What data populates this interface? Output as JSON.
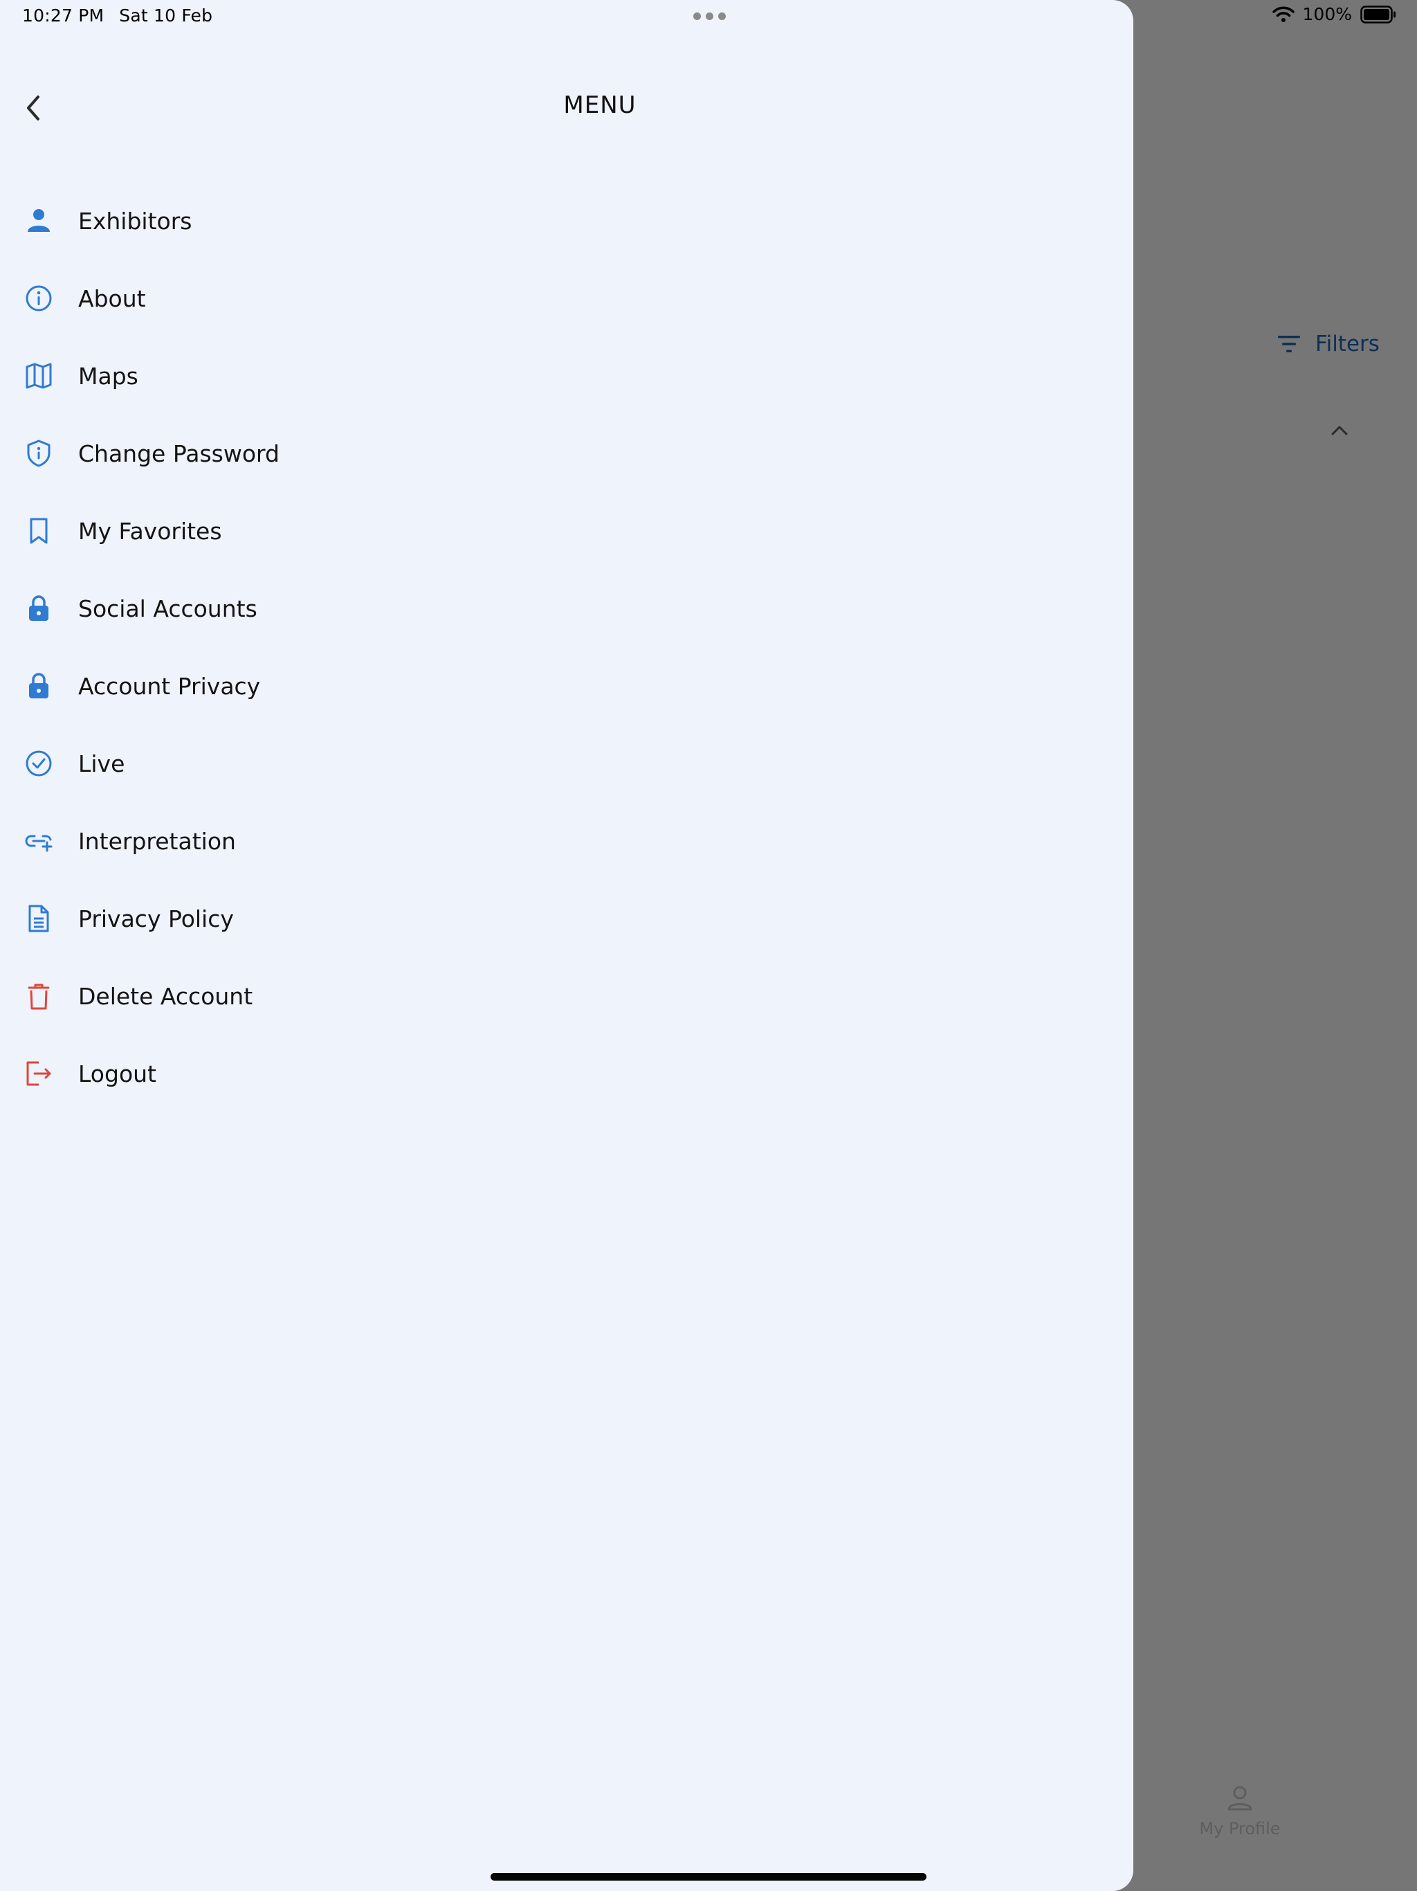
{
  "status_bar": {
    "time": "10:27 PM",
    "date": "Sat 10 Feb",
    "battery": "100%"
  },
  "background": {
    "filters_label": "Filters",
    "tab_my_profile": "My Profile"
  },
  "drawer": {
    "title": "MENU",
    "items": [
      {
        "label": "Exhibitors",
        "icon": "person-icon"
      },
      {
        "label": "About",
        "icon": "info-circle-icon"
      },
      {
        "label": "Maps",
        "icon": "map-icon"
      },
      {
        "label": "Change Password",
        "icon": "shield-info-icon"
      },
      {
        "label": "My Favorites",
        "icon": "bookmark-icon"
      },
      {
        "label": "Social Accounts",
        "icon": "lock-icon"
      },
      {
        "label": "Account Privacy",
        "icon": "lock-icon"
      },
      {
        "label": "Live",
        "icon": "check-circle-icon"
      },
      {
        "label": "Interpretation",
        "icon": "link-add-icon"
      },
      {
        "label": "Privacy Policy",
        "icon": "document-icon"
      },
      {
        "label": "Delete Account",
        "icon": "trash-icon"
      },
      {
        "label": "Logout",
        "icon": "logout-icon"
      }
    ]
  },
  "colors": {
    "accent": "#2f7bd1",
    "danger": "#e3443a",
    "drawer_bg": "#eff3fb",
    "overlay": "#767676"
  }
}
